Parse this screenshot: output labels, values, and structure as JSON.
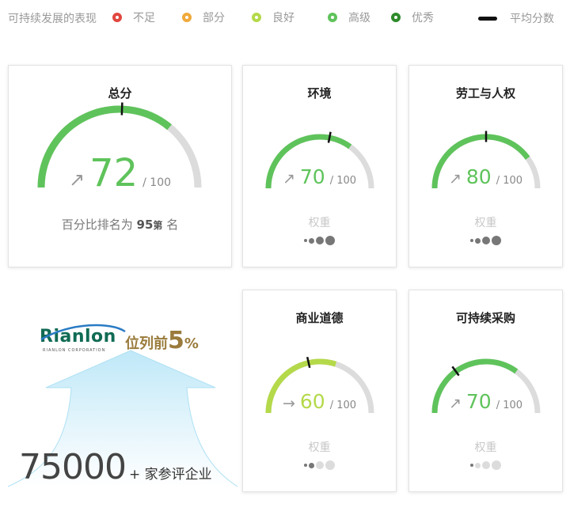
{
  "legend": {
    "label": "可持续发展的表现",
    "items": [
      {
        "label": "不足",
        "color": "#e0473f"
      },
      {
        "label": "部分",
        "color": "#f0a93b"
      },
      {
        "label": "良好",
        "color": "#b4d94a"
      },
      {
        "label": "高级",
        "color": "#5fc35b"
      },
      {
        "label": "优秀",
        "color": "#2e8b2a"
      }
    ],
    "avg_label": "平均分数"
  },
  "overall": {
    "title": "总分",
    "score": "72",
    "out_of": "/ 100",
    "trend_icon": "arrow-up-right-icon",
    "rank_prefix": "百分比排名为",
    "rank_value": "95",
    "rank_mid": "第",
    "rank_suffix": "名",
    "score_value": 72,
    "average_value": 51,
    "color": "#5fc35b"
  },
  "themes": [
    {
      "title": "环境",
      "score": "70",
      "out_of": "/ 100",
      "trend": "↗",
      "trend_icon": "arrow-up-right-icon",
      "weight_label": "权重",
      "weight_level": 4,
      "score_value": 70,
      "average_value": 56,
      "color": "#5fc35b"
    },
    {
      "title": "劳工与人权",
      "score": "80",
      "out_of": "/ 100",
      "trend": "↗",
      "trend_icon": "arrow-up-right-icon",
      "weight_label": "权重",
      "weight_level": 4,
      "score_value": 80,
      "average_value": 50,
      "color": "#5fc35b"
    },
    {
      "title": "商业道德",
      "score": "60",
      "out_of": "/ 100",
      "trend": "→",
      "trend_icon": "arrow-right-icon",
      "weight_label": "权重",
      "weight_level": 2,
      "score_value": 60,
      "average_value": 43,
      "color": "#b4d94a"
    },
    {
      "title": "可持续采购",
      "score": "70",
      "out_of": "/ 100",
      "trend": "↗",
      "trend_icon": "arrow-up-right-icon",
      "weight_label": "权重",
      "weight_level": 1,
      "score_value": 70,
      "average_value": 30,
      "color": "#5fc35b"
    }
  ],
  "promo": {
    "logo_text": "Rianlon",
    "logo_sub": "RIANLON CORPORATION",
    "rank_text": "位列前",
    "rank_pct": "5",
    "rank_unit": "%",
    "count": "75000",
    "count_suffix": "+ 家参评企业"
  }
}
